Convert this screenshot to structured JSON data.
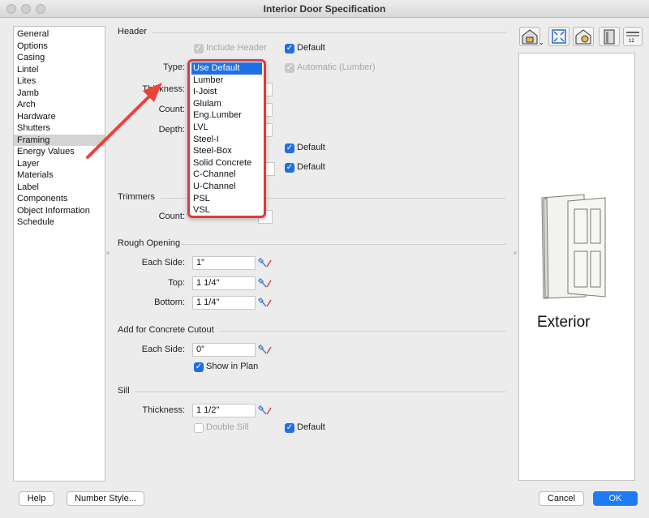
{
  "window": {
    "title": "Interior Door Specification"
  },
  "sidebar": {
    "items": [
      "General",
      "Options",
      "Casing",
      "Lintel",
      "Lites",
      "Jamb",
      "Arch",
      "Hardware",
      "Shutters",
      "Framing",
      "Energy Values",
      "Layer",
      "Materials",
      "Label",
      "Components",
      "Object Information",
      "Schedule"
    ],
    "selected": "Framing"
  },
  "header": {
    "section": "Header",
    "include_header": "Include Header",
    "default": "Default",
    "type_label": "Type:",
    "automatic": "Automatic (Lumber)",
    "thickness_label": "Thickness:",
    "count_label": "Count:",
    "depth_label": "Depth:",
    "default2": "Default",
    "default3": "Default"
  },
  "type_dropdown": {
    "options": [
      "Use Default",
      "Lumber",
      "I-Joist",
      "Glulam",
      "Eng.Lumber",
      "LVL",
      "Steel-I",
      "Steel-Box",
      "Solid Concrete",
      "C-Channel",
      "U-Channel",
      "PSL",
      "VSL"
    ],
    "selected": "Use Default"
  },
  "trimmers": {
    "section": "Trimmers",
    "count_label": "Count:"
  },
  "rough_opening": {
    "section": "Rough Opening",
    "each_side_label": "Each Side:",
    "each_side": "1\"",
    "top_label": "Top:",
    "top": "1 1/4\"",
    "bottom_label": "Bottom:",
    "bottom": "1 1/4\""
  },
  "concrete_cutout": {
    "section": "Add for Concrete Cutout",
    "each_side_label": "Each Side:",
    "each_side": "0\"",
    "show_in_plan": "Show in Plan"
  },
  "sill": {
    "section": "Sill",
    "thickness_label": "Thickness:",
    "thickness": "1 1/2\"",
    "double_sill": "Double Sill",
    "default": "Default"
  },
  "preview": {
    "label": "Exterior"
  },
  "buttons": {
    "help": "Help",
    "number_style": "Number Style...",
    "cancel": "Cancel",
    "ok": "OK"
  },
  "colors": {
    "accent": "#1f6fe5",
    "highlight_border": "#e03a3a",
    "arrow": "#e8443a"
  }
}
